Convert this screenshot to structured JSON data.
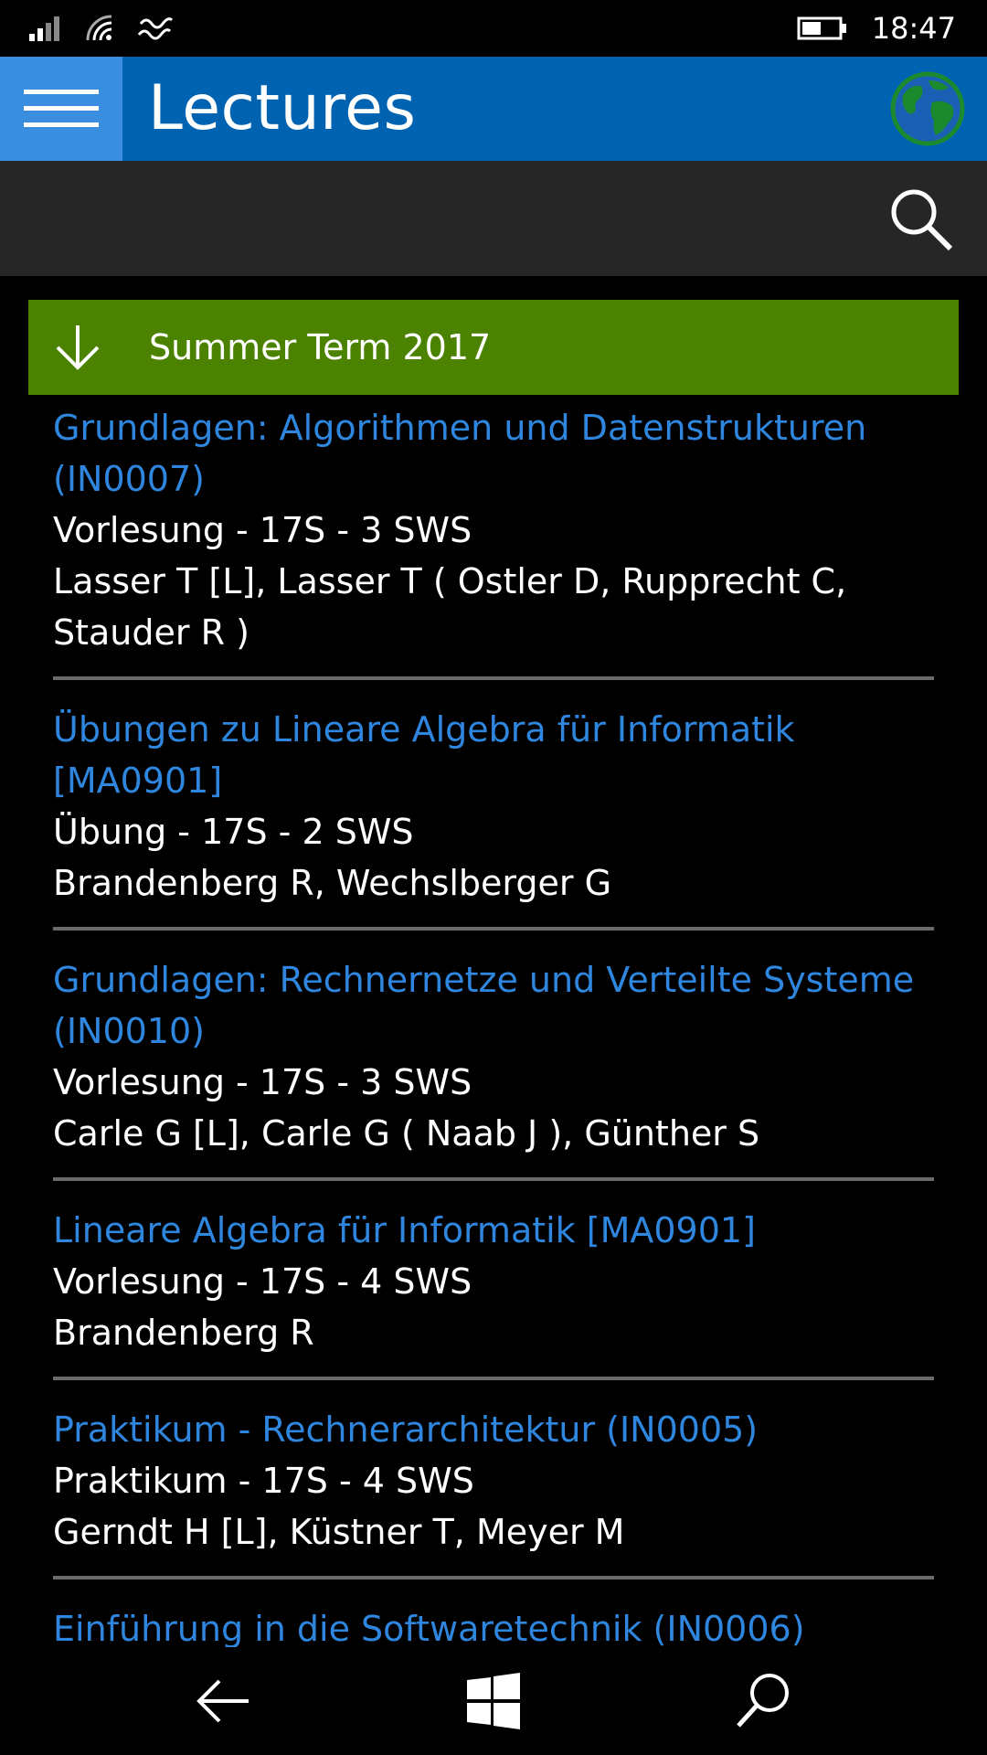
{
  "status_bar": {
    "time": "18:47",
    "icons": [
      "signal-icon",
      "wifi-icon",
      "data-sense-icon",
      "battery-icon"
    ]
  },
  "header": {
    "title": "Lectures",
    "menu_icon": "hamburger-icon",
    "globe_icon": "globe-icon"
  },
  "search": {
    "icon": "search-icon"
  },
  "term": {
    "label": "Summer Term 2017",
    "icon": "arrow-down-icon"
  },
  "lectures": [
    {
      "title": "Grundlagen: Algorithmen und Datenstrukturen (IN0007)",
      "meta": "Vorlesung - 17S - 3 SWS",
      "people": "Lasser T [L], Lasser T ( Ostler D, Rupprecht C, Stauder R )"
    },
    {
      "title": "Übungen zu Lineare Algebra für Informatik [MA0901]",
      "meta": "Übung - 17S - 2 SWS",
      "people": "Brandenberg R, Wechslberger G"
    },
    {
      "title": "Grundlagen: Rechnernetze und Verteilte Systeme (IN0010)",
      "meta": "Vorlesung - 17S - 3 SWS",
      "people": "Carle G [L], Carle G ( Naab J ), Günther S"
    },
    {
      "title": "Lineare Algebra für Informatik [MA0901]",
      "meta": "Vorlesung - 17S - 4 SWS",
      "people": "Brandenberg R"
    },
    {
      "title": "Praktikum - Rechnerarchitektur (IN0005)",
      "meta": "Praktikum - 17S - 4 SWS",
      "people": "Gerndt H [L], Küstner T, Meyer M"
    },
    {
      "title": "Einführung in die Softwaretechnik (IN0006)"
    }
  ],
  "nav_bar": {
    "back_icon": "back-arrow-icon",
    "start_icon": "windows-logo-icon",
    "search_icon": "search-icon"
  },
  "colors": {
    "header_bg": "#0063b1",
    "hamburger_bg": "#3a8ee0",
    "term_bg": "#4b8200",
    "link": "#2e86de",
    "search_bar_bg": "#262626"
  }
}
